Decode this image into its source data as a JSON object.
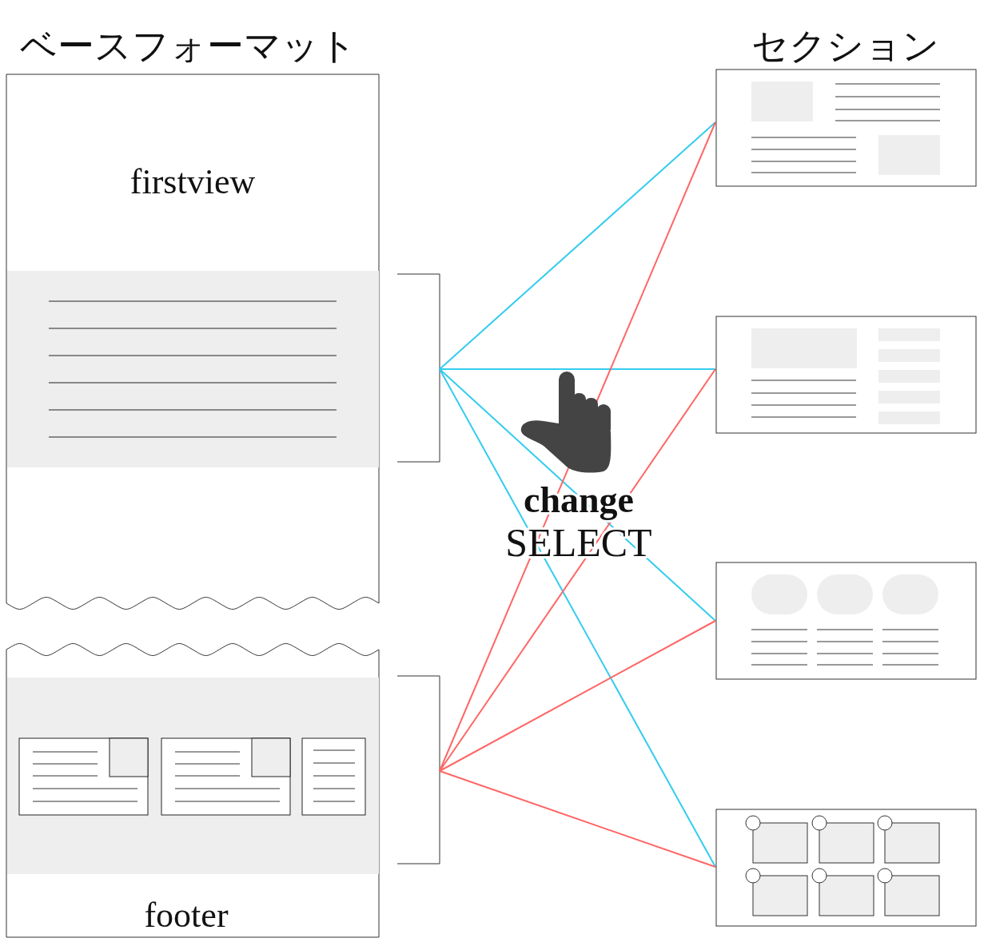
{
  "base_format": {
    "title": "ベースフォーマット",
    "firstview_label": "firstview",
    "footer_label": "footer"
  },
  "sections_title": "セクション",
  "action": {
    "line_1": "change",
    "line_2": "SELECT"
  },
  "brackets": [
    {
      "color": "#33ccee"
    },
    {
      "color": "#ff6666"
    }
  ],
  "sections": [
    {
      "kind": "text-blocks"
    },
    {
      "kind": "sidebar-list"
    },
    {
      "kind": "rounded-cards"
    },
    {
      "kind": "photo-grid"
    }
  ]
}
